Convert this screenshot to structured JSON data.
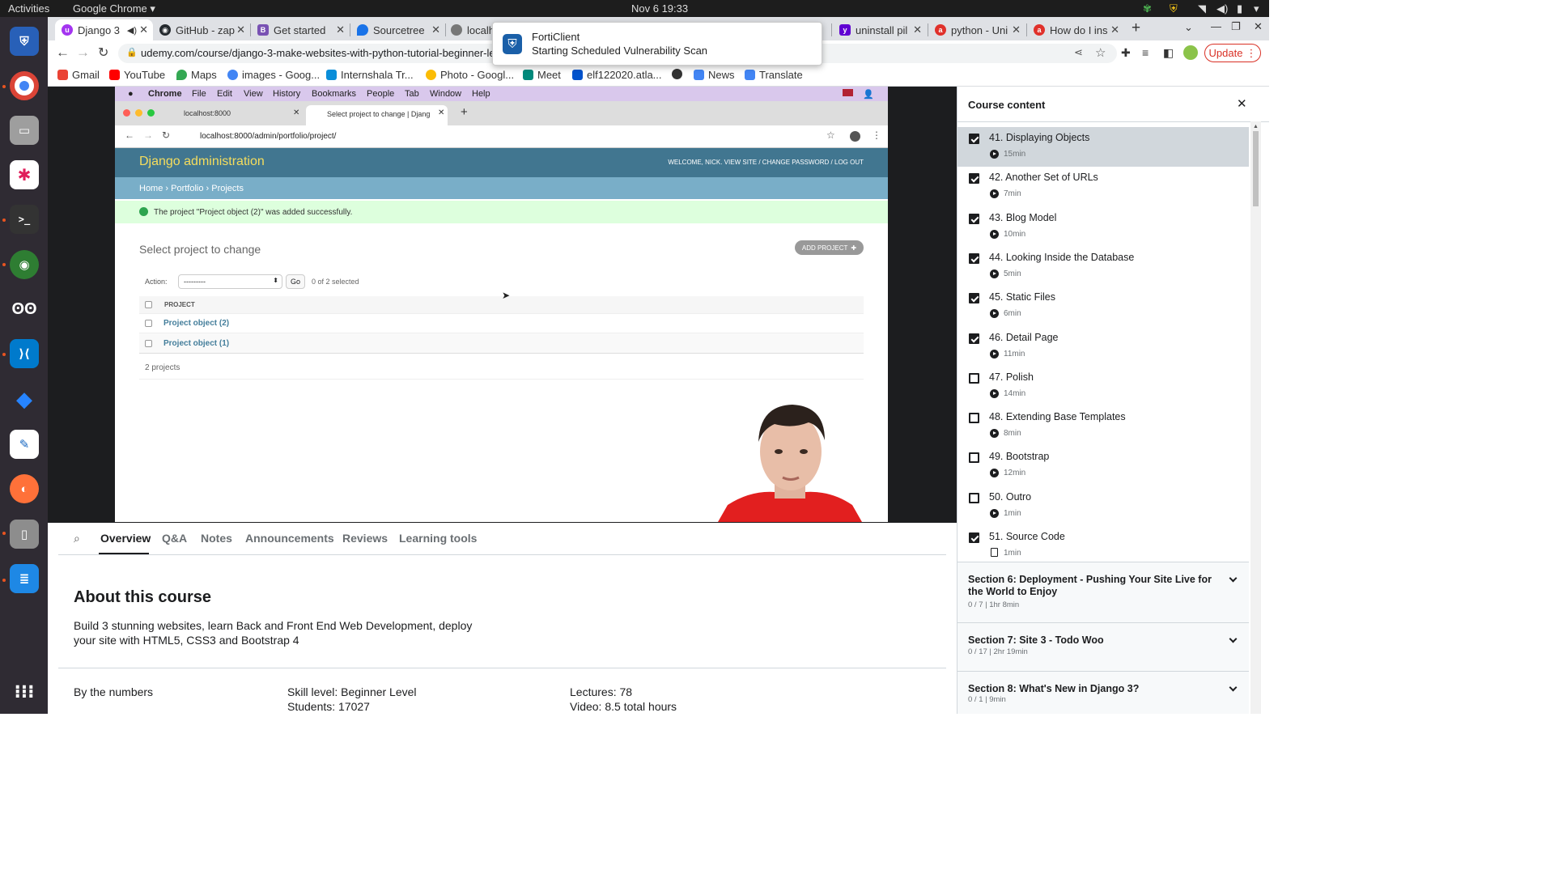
{
  "system": {
    "activities": "Activities",
    "app_menu": "Google Chrome",
    "datetime": "Nov 6  19:33"
  },
  "tabs": [
    {
      "label": "Django 3",
      "icon": "udemy-icon",
      "color": "#a435f0"
    },
    {
      "label": "GitHub - zap",
      "icon": "github-icon",
      "color": "#24292e"
    },
    {
      "label": "Get started",
      "icon": "bootstrap-icon",
      "color": "#7952b3"
    },
    {
      "label": "Sourcetree",
      "icon": "maps-pin-icon",
      "color": "#1a73e8"
    },
    {
      "label": "localh",
      "icon": "globe-icon",
      "color": "#777"
    },
    {
      "label": "uninstall pil",
      "icon": "yahoo-icon",
      "color": "#6001d2"
    },
    {
      "label": "python - Uni",
      "icon": "ask-icon",
      "color": "#e0312b"
    },
    {
      "label": "How do I ins",
      "icon": "ask-icon",
      "color": "#e0312b"
    }
  ],
  "address": {
    "url": "udemy.com/course/django-3-make-websites-with-python-tutorial-beginner-learn-boo",
    "update": "Update"
  },
  "bookmarks": [
    {
      "label": "Gmail",
      "color": "#ea4335"
    },
    {
      "label": "YouTube",
      "color": "#ff0000"
    },
    {
      "label": "Maps",
      "color": "#34a853"
    },
    {
      "label": "images - Goog...",
      "color": "#4285f4"
    },
    {
      "label": "Internshala Tr...",
      "color": "#0a8ed9"
    },
    {
      "label": "Photo - Googl...",
      "color": "#fbbc05"
    },
    {
      "label": "Meet",
      "color": "#00897b"
    },
    {
      "label": "elf122020.atla...",
      "color": "#0052cc"
    },
    {
      "label": "",
      "color": "#333"
    },
    {
      "label": "News",
      "color": "#4285f4"
    },
    {
      "label": "Translate",
      "color": "#4285f4"
    }
  ],
  "notification": {
    "title": "FortiClient",
    "body": "Starting Scheduled Vulnerability Scan"
  },
  "video": {
    "mac_menu": [
      "Chrome",
      "File",
      "Edit",
      "View",
      "History",
      "Bookmarks",
      "People",
      "Tab",
      "Window",
      "Help"
    ],
    "mac_tabs": [
      "localhost:8000",
      "Select project to change | Djang"
    ],
    "mac_url": "localhost:8000/admin/portfolio/project/",
    "dj_title": "Django administration",
    "dj_welcome": "WELCOME, NICK. VIEW SITE / CHANGE PASSWORD / LOG OUT",
    "breadcrumb": "Home › Portfolio › Projects",
    "success_msg": "The project \"Project object (2)\" was added successfully.",
    "heading": "Select project to change",
    "add_button": "ADD PROJECT",
    "action_label": "Action:",
    "action_value": "---------",
    "go": "Go",
    "selected": "0 of 2 selected",
    "column": "PROJECT",
    "rows": [
      "Project object (2)",
      "Project object (1)"
    ],
    "count": "2 projects"
  },
  "course_tabs": [
    "Overview",
    "Q&A",
    "Notes",
    "Announcements",
    "Reviews",
    "Learning tools"
  ],
  "about": {
    "title": "About this course",
    "description": "Build 3 stunning websites, learn Back and Front End Web Development, deploy your site with HTML5, CSS3 and Bootstrap 4"
  },
  "numbers": {
    "label": "By the numbers",
    "skill": "Skill level: Beginner Level",
    "students": "Students: 17027",
    "lectures": "Lectures: 78",
    "video": "Video: 8.5 total hours"
  },
  "sidebar": {
    "title": "Course content",
    "lectures": [
      {
        "title": "41. Displaying Objects",
        "dur": "15min",
        "done": true,
        "type": "video"
      },
      {
        "title": "42. Another Set of URLs",
        "dur": "7min",
        "done": true,
        "type": "video"
      },
      {
        "title": "43. Blog Model",
        "dur": "10min",
        "done": true,
        "type": "video"
      },
      {
        "title": "44. Looking Inside the Database",
        "dur": "5min",
        "done": true,
        "type": "video"
      },
      {
        "title": "45. Static Files",
        "dur": "6min",
        "done": true,
        "type": "video"
      },
      {
        "title": "46. Detail Page",
        "dur": "11min",
        "done": true,
        "type": "video"
      },
      {
        "title": "47. Polish",
        "dur": "14min",
        "done": false,
        "type": "video"
      },
      {
        "title": "48. Extending Base Templates",
        "dur": "8min",
        "done": false,
        "type": "video"
      },
      {
        "title": "49. Bootstrap",
        "dur": "12min",
        "done": false,
        "type": "video"
      },
      {
        "title": "50. Outro",
        "dur": "1min",
        "done": false,
        "type": "video"
      },
      {
        "title": "51. Source Code",
        "dur": "1min",
        "done": true,
        "type": "doc"
      }
    ],
    "sections": [
      {
        "title": "Section 6: Deployment - Pushing Your Site Live for the World to Enjoy",
        "meta": "0 / 7 | 1hr 8min"
      },
      {
        "title": "Section 7: Site 3 - Todo Woo",
        "meta": "0 / 17 | 2hr 19min"
      },
      {
        "title": "Section 8: What's New in Django 3?",
        "meta": "0 / 1 | 9min"
      }
    ]
  }
}
